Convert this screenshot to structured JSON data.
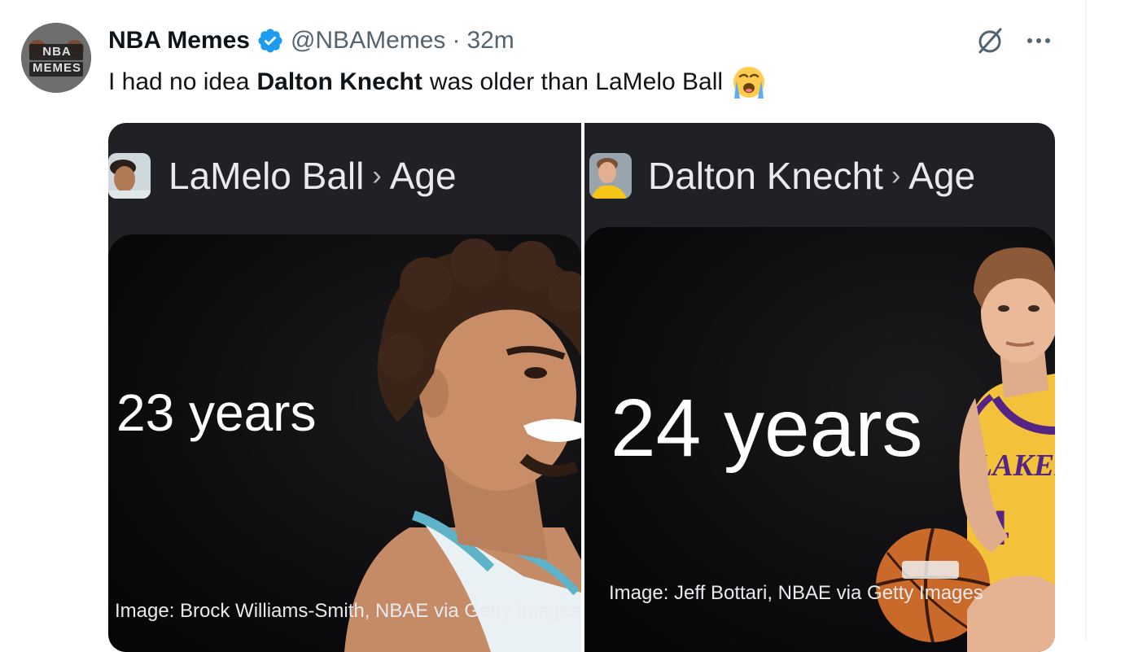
{
  "author": {
    "display_name": "NBA Memes",
    "handle": "@NBAMemes",
    "separator": "·",
    "time": "32m",
    "avatar_text": "NBA MEMES"
  },
  "tweet": {
    "text_before": "I had no idea",
    "text_bold": "Dalton Knecht",
    "text_after": "was older than LaMelo Ball",
    "emoji": "loudly-crying-face"
  },
  "actions": {
    "grok_icon": "grok-icon",
    "more_icon": "more-icon"
  },
  "media": [
    {
      "entity": "LaMelo Ball",
      "separator": "›",
      "attribute": "Age",
      "value": "23 years",
      "caption": "Image: Brock Williams-Smith, NBAE via Getty Images"
    },
    {
      "entity": "Dalton Knecht",
      "separator": "›",
      "attribute": "Age",
      "value": "24 years",
      "caption": "Image: Jeff Bottari, NBAE via Getty Images"
    }
  ],
  "colors": {
    "verified": "#1d9bf0",
    "text_primary": "#0f1419",
    "text_secondary": "#536471",
    "panel_bg": "#202124"
  }
}
